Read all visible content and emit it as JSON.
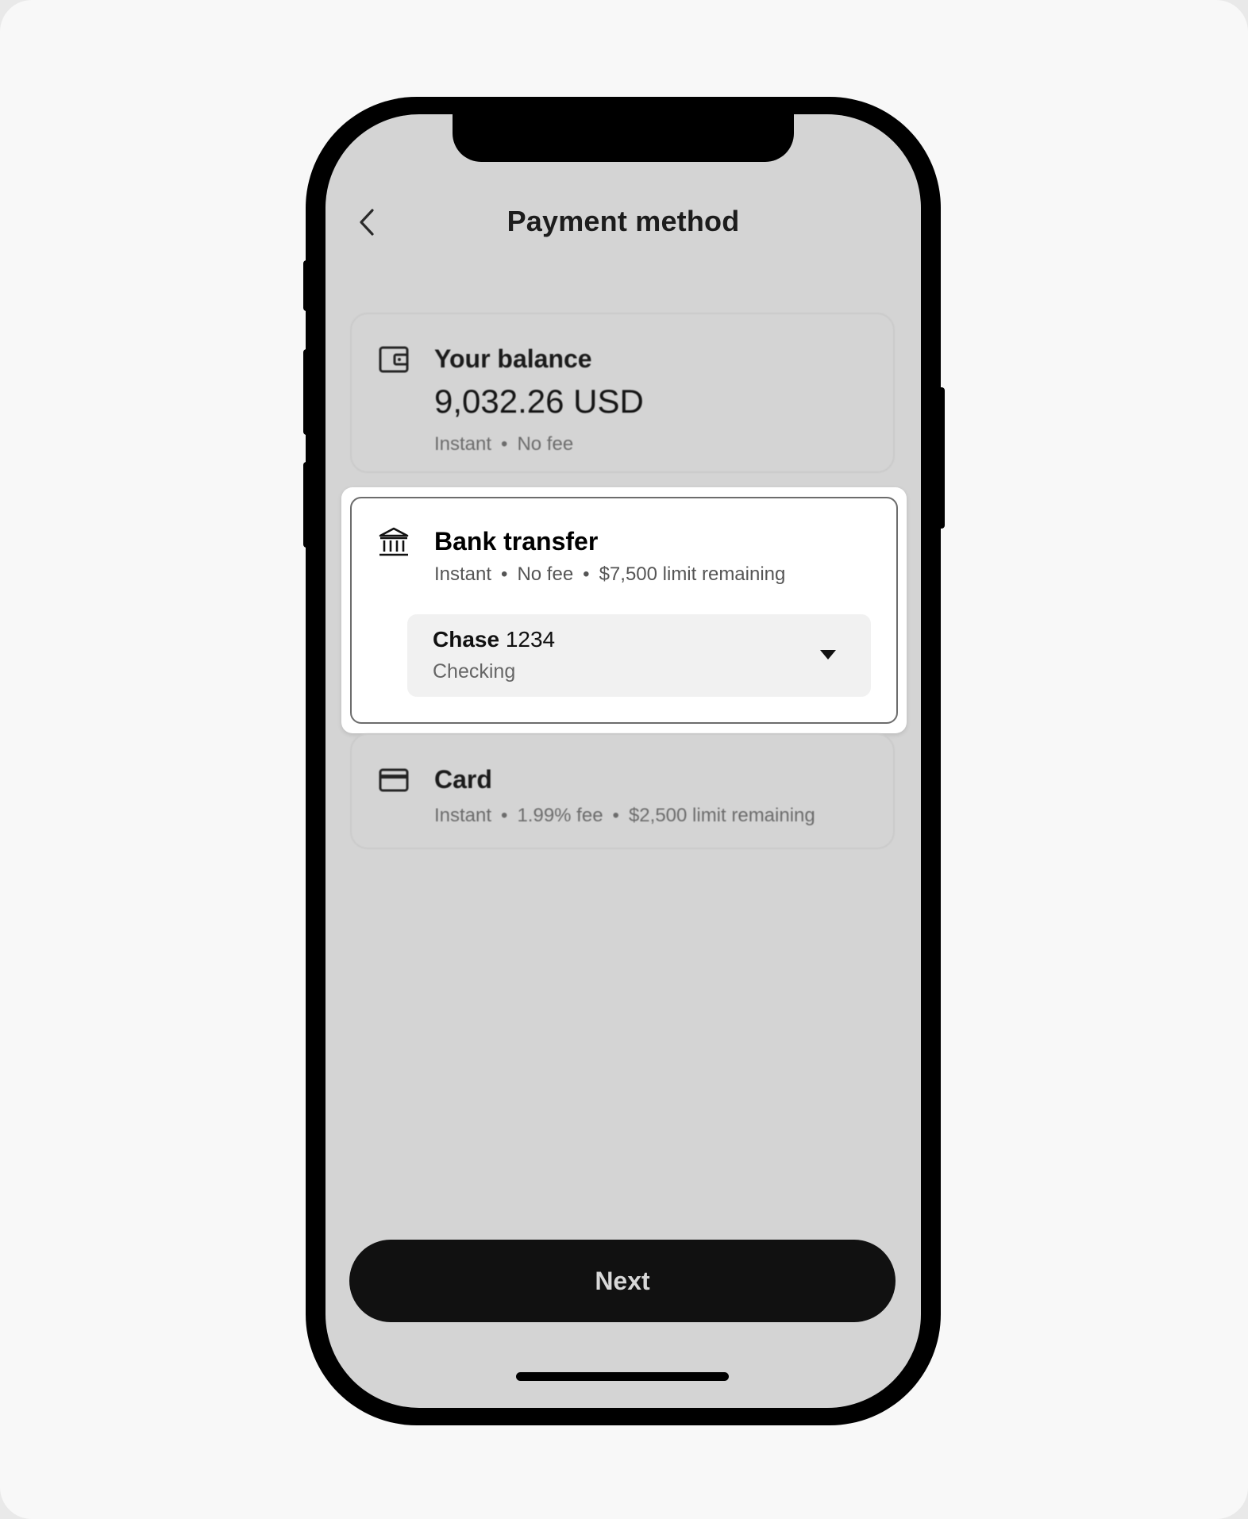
{
  "header": {
    "title": "Payment method",
    "back_icon": "chevron-left-icon"
  },
  "options": {
    "balance": {
      "icon": "wallet-icon",
      "title": "Your balance",
      "amount": "9,032.26 USD",
      "meta": [
        "Instant",
        "No fee"
      ]
    },
    "bank": {
      "icon": "bank-icon",
      "title": "Bank transfer",
      "meta": [
        "Instant",
        "No fee",
        "$7,500 limit remaining"
      ],
      "selected": true,
      "account": {
        "bank_name": "Chase",
        "number": "1234",
        "type": "Checking",
        "dropdown_icon": "chevron-down-icon"
      }
    },
    "card": {
      "icon": "credit-card-icon",
      "title": "Card",
      "meta": [
        "Instant",
        "1.99% fee",
        "$2,500 limit remaining"
      ]
    }
  },
  "footer": {
    "next_label": "Next"
  },
  "separator": "•",
  "colors": {
    "screen_bg": "#d4d4d4",
    "button_bg": "#111111",
    "selected_border": "#6c6c6c"
  }
}
